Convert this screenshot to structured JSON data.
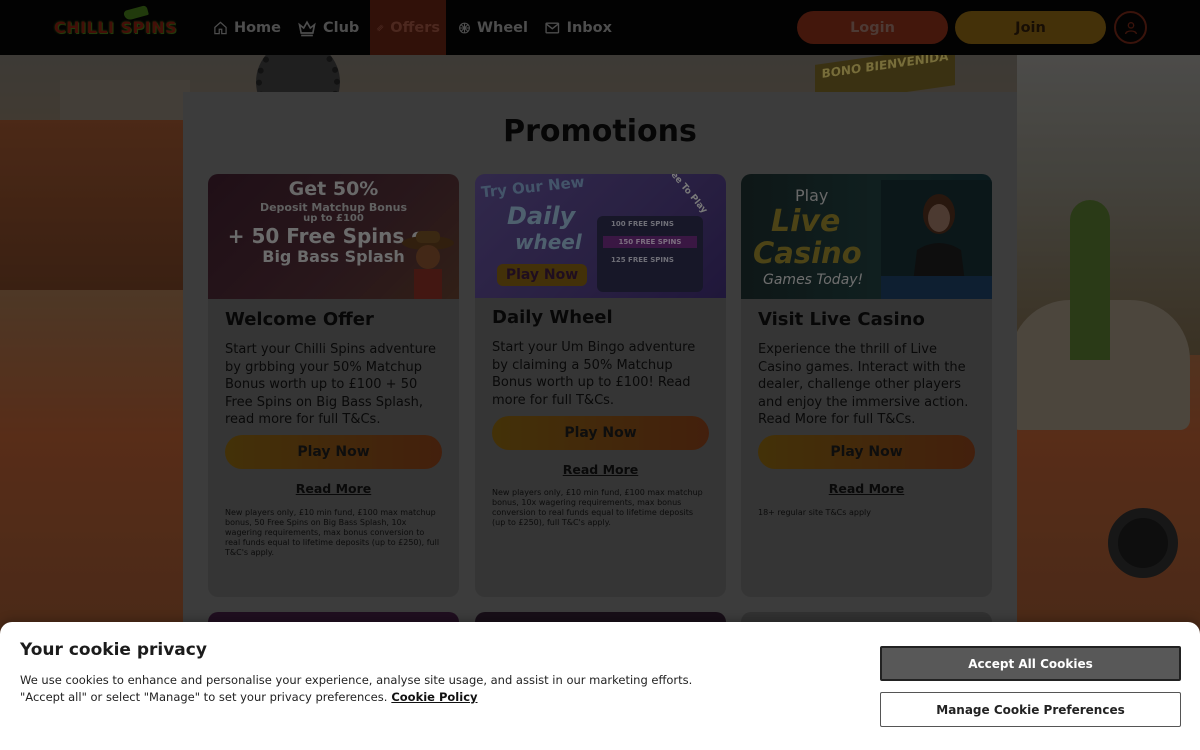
{
  "brand": {
    "name": "CHILLI SPINS"
  },
  "nav": {
    "items": [
      {
        "label": "Home",
        "icon": "home-icon"
      },
      {
        "label": "Club",
        "icon": "crown-icon"
      },
      {
        "label": "Offers",
        "icon": "ticket-icon",
        "active": true
      },
      {
        "label": "Wheel",
        "icon": "wheel-icon"
      },
      {
        "label": "Inbox",
        "icon": "mail-icon"
      }
    ],
    "login_label": "Login",
    "join_label": "Join",
    "account_icon": "user-icon"
  },
  "page": {
    "title": "Promotions",
    "background_sign": "BONO BIENVENIDA"
  },
  "promotions": [
    {
      "image_lines": [
        "Get 50%",
        "Deposit Matchup Bonus",
        "up to £100",
        "+ 50 Free Spins on",
        "Big Bass Splash"
      ],
      "title": "Welcome Offer",
      "description": "Start your Chilli Spins adventure by grbbing your 50% Matchup Bonus worth up to £100 + 50 Free Spins on Big Bass Splash, read more for full T&Cs.",
      "play_label": "Play Now",
      "read_more_label": "Read More",
      "terms": "New players only, £10 min fund, £100 max matchup bonus, 50 Free Spins on Big Bass Splash, 10x wagering requirements, max bonus conversion to real funds equal to lifetime deposits (up to £250), full T&C's apply."
    },
    {
      "image_lines": [
        "Try Our New",
        "Daily",
        "wheel",
        "Play Now",
        "Free To Play",
        "100 FREE SPINS",
        "150 FREE SPINS",
        "125 FREE SPINS"
      ],
      "title": "Daily Wheel",
      "description": "Start your Um Bingo adventure by claiming a 50% Matchup Bonus worth up to £100! Read more for full T&Cs.",
      "play_label": "Play Now",
      "read_more_label": "Read More",
      "terms": "New players only, £10 min fund, £100 max matchup bonus, 10x wagering requirements, max bonus conversion to real funds equal to lifetime deposits (up to £250), full T&C's apply."
    },
    {
      "image_lines": [
        "Play",
        "Live",
        "Casino",
        "Games Today!"
      ],
      "title": "Visit Live Casino",
      "description": "Experience the thrill of Live Casino games. Interact with the dealer, challenge other players and enjoy the immersive action. Read More for full T&Cs.",
      "play_label": "Play Now",
      "read_more_label": "Read More",
      "terms": "18+ regular site T&Cs apply"
    }
  ],
  "cookie": {
    "title": "Your cookie privacy",
    "text": "We use cookies to enhance and personalise your experience, analyse site usage, and assist in our marketing efforts. \"Accept all\" or select \"Manage\" to set your privacy preferences.",
    "policy_label": "Cookie Policy",
    "accept_label": "Accept All Cookies",
    "manage_label": "Manage Cookie Preferences"
  },
  "colors": {
    "header_bg": "#050505",
    "login": "#7a2a17",
    "join": "#7c5a12",
    "offers_active": "#5a1f12",
    "accept_button": "#585858"
  }
}
